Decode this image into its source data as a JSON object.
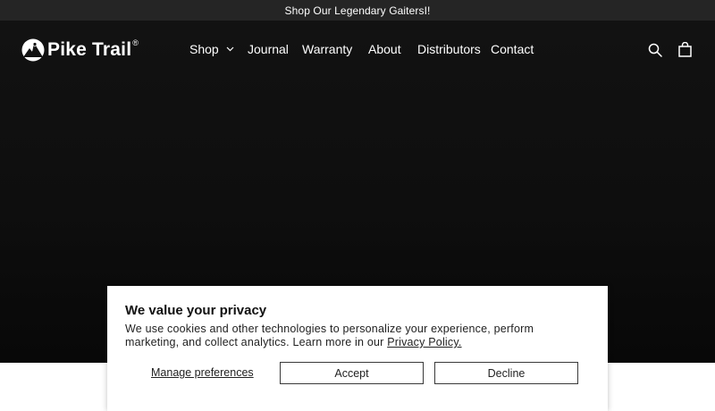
{
  "announcement": {
    "text": "Shop Our Legendary GaitersI!"
  },
  "header": {
    "logo": {
      "name": "Pike Trail",
      "registered_mark": "®",
      "icon": "mountain-hiker-logo-icon"
    },
    "nav": [
      {
        "label": "Shop",
        "has_dropdown": true
      },
      {
        "label": "Journal"
      },
      {
        "label": "Warranty"
      },
      {
        "label": "About"
      },
      {
        "label": "Distributors"
      },
      {
        "label": "Contact"
      }
    ],
    "icons": {
      "search": "search-icon",
      "cart": "cart-icon"
    }
  },
  "consent": {
    "title": "We value your privacy",
    "body": "We use cookies and other technologies to personalize your experience, perform marketing, and collect analytics. Learn more in our",
    "policy_link": "Privacy Policy.",
    "manage_label": "Manage preferences",
    "accept_label": "Accept",
    "decline_label": "Decline"
  },
  "colors": {
    "announcement_bg": "#252525",
    "hero_bg": "#0e0e0e",
    "text_light": "#ffffff",
    "text_dark": "#222222"
  }
}
